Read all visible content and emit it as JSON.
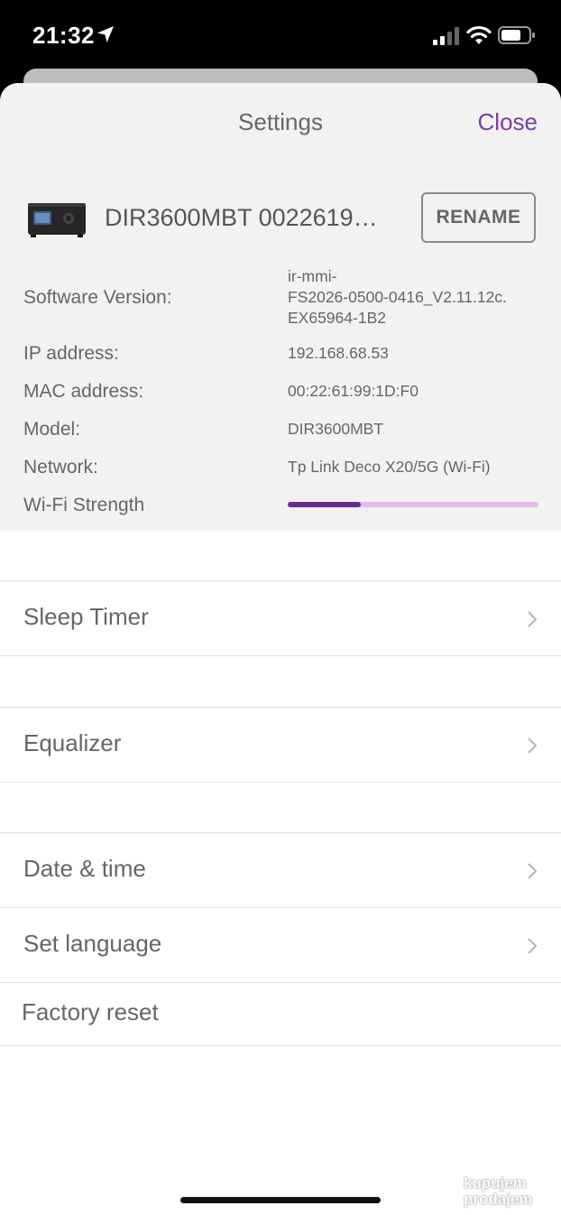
{
  "status_bar": {
    "time": "21:32"
  },
  "header": {
    "title": "Settings",
    "close_label": "Close"
  },
  "device": {
    "name": "DIR3600MBT 0022619…",
    "rename_label": "RENAME"
  },
  "info": {
    "software_version": {
      "label": "Software Version:",
      "value_lines": [
        "ir-mmi-",
        "FS2026-0500-0416_V2.11.12c.",
        "EX65964-1B2"
      ]
    },
    "ip_address": {
      "label": "IP address:",
      "value": "192.168.68.53"
    },
    "mac_address": {
      "label": "MAC address:",
      "value": "00:22:61:99:1D:F0"
    },
    "model": {
      "label": "Model:",
      "value": "DIR3600MBT"
    },
    "network": {
      "label": "Network:",
      "value": "Tp Link Deco X20/5G (Wi-Fi)"
    },
    "wifi_strength": {
      "label": "Wi-Fi Strength",
      "level_fraction": 0.29
    }
  },
  "menu": {
    "sleep_timer": "Sleep Timer",
    "equalizer": "Equalizer",
    "date_time": "Date & time",
    "set_language": "Set language",
    "factory_reset": "Factory reset"
  },
  "watermark": {
    "line1": "kupujem",
    "line2": "prodajem"
  },
  "colors": {
    "accent": "#7a3e9e",
    "wifi_fill": "#6a2a93",
    "wifi_track": "#e2bde8",
    "top_bg": "#f2f2f2"
  }
}
